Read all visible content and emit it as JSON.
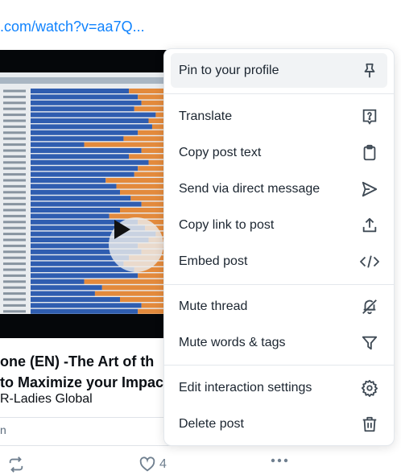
{
  "post": {
    "link_text": ".com/watch?v=aa7Q...",
    "card": {
      "title_line1": "one (EN) -The Art of th",
      "title_line2": "to Maximize your Impac",
      "author": "R-Ladies Global",
      "domain": "n"
    },
    "actions": {
      "like_count": "4"
    }
  },
  "menu": {
    "items": [
      {
        "label": "Pin to your profile",
        "icon": "pin-icon"
      },
      {
        "label": "Translate",
        "icon": "translate-icon"
      },
      {
        "label": "Copy post text",
        "icon": "clipboard-icon"
      },
      {
        "label": "Send via direct message",
        "icon": "send-icon"
      },
      {
        "label": "Copy link to post",
        "icon": "share-icon"
      },
      {
        "label": "Embed post",
        "icon": "code-icon"
      },
      {
        "label": "Mute thread",
        "icon": "mute-bell-icon"
      },
      {
        "label": "Mute words & tags",
        "icon": "filter-icon"
      },
      {
        "label": "Edit interaction settings",
        "icon": "gear-icon"
      },
      {
        "label": "Delete post",
        "icon": "trash-icon"
      }
    ]
  },
  "colors": {
    "link": "#1083fe",
    "chart_blue": "#2f5db0",
    "chart_orange": "#e38a3c",
    "menu_highlight": "#f1f3f5"
  }
}
